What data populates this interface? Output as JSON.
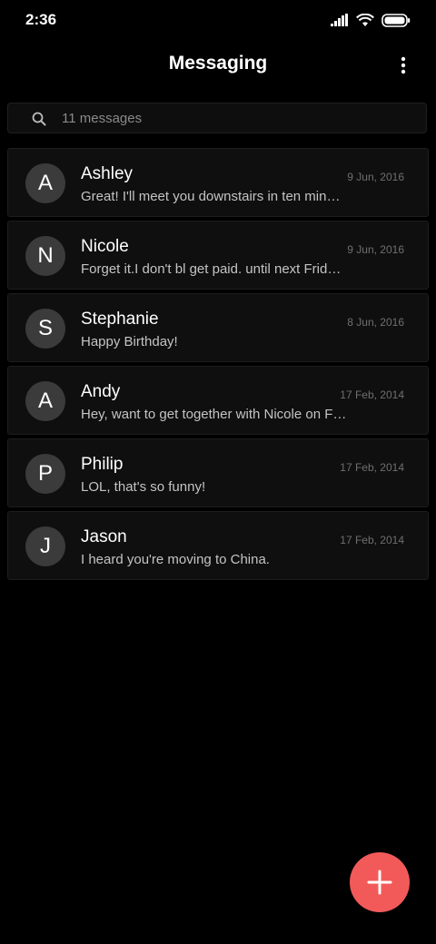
{
  "status_bar": {
    "time": "2:36",
    "icons": [
      "signal-icon",
      "wifi-icon",
      "battery-icon"
    ]
  },
  "app_bar": {
    "title": "Messaging",
    "menu_icon": "more-vert-icon"
  },
  "search": {
    "icon": "search-icon",
    "text": "11 messages"
  },
  "conversations": [
    {
      "initial": "A",
      "name": "Ashley",
      "date": "9 Jun, 2016",
      "preview": "Great! I'll meet you downstairs in ten min…"
    },
    {
      "initial": "N",
      "name": "Nicole",
      "date": "9 Jun, 2016",
      "preview": "Forget it.I don't bl get paid. until next Frid…"
    },
    {
      "initial": "S",
      "name": "Stephanie",
      "date": "8 Jun, 2016",
      "preview": "Happy Birthday!"
    },
    {
      "initial": "A",
      "name": "Andy",
      "date": "17 Feb, 2014",
      "preview": "Hey, want to get together with Nicole on F…"
    },
    {
      "initial": "P",
      "name": "Philip",
      "date": "17 Feb, 2014",
      "preview": "LOL, that's so funny!"
    },
    {
      "initial": "J",
      "name": "Jason",
      "date": "17 Feb, 2014",
      "preview": "I heard you're moving to China."
    }
  ],
  "fab": {
    "icon": "plus-icon",
    "color": "#f25a5a"
  },
  "colors": {
    "background": "#000000",
    "item_background": "#0f0f0f",
    "avatar": "#3b3b3b",
    "accent": "#f25a5a"
  }
}
